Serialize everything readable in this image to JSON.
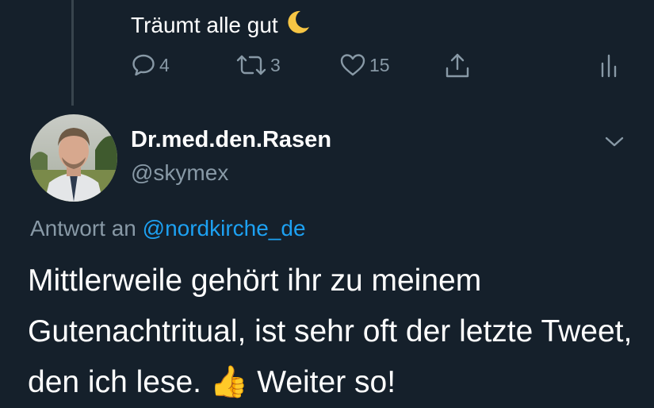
{
  "previous_tweet": {
    "text": "Träumt alle gut",
    "emoji_icon": "crescent-moon-icon",
    "actions": {
      "reply_count": "4",
      "retweet_count": "3",
      "like_count": "15"
    }
  },
  "tweet": {
    "display_name": "Dr.med.den.Rasen",
    "handle": "@skymex",
    "reply_prefix": "Antwort an ",
    "reply_mention": "@nordkirche_de",
    "text": "Mittlerweile gehört ihr zu meinem Gutenachtritual, ist sehr oft der letzte Tweet, den ich lese. 👍 Weiter so!"
  },
  "colors": {
    "background": "#15202b",
    "text_primary": "#ffffff",
    "text_secondary": "#8899a6",
    "link": "#1da1f2",
    "moon": "#f6c544"
  }
}
